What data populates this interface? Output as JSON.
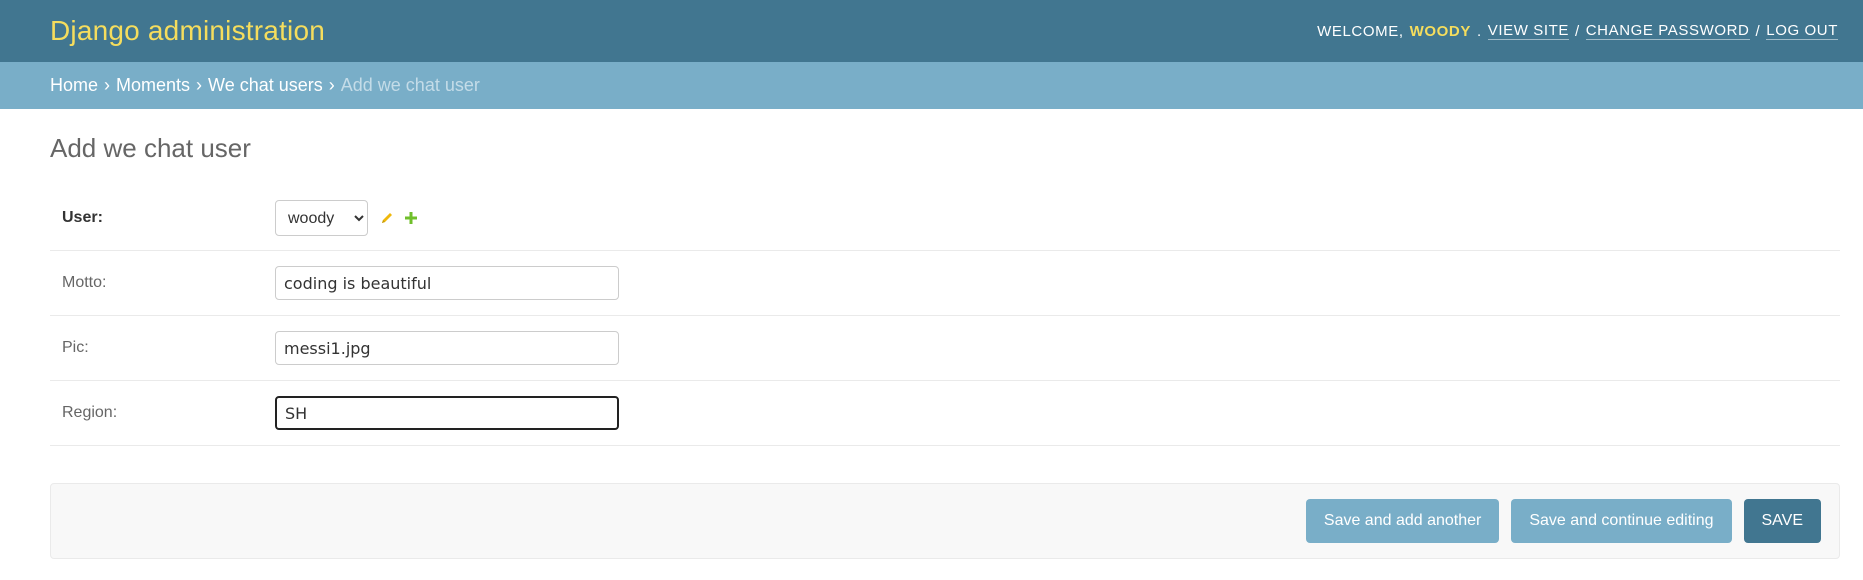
{
  "header": {
    "branding": "Django administration",
    "welcome": "Welcome,",
    "username": "woody",
    "view_site": "View site",
    "change_password": "Change password",
    "log_out": "Log out"
  },
  "breadcrumbs": {
    "home": "Home",
    "app": "Moments",
    "model": "We chat users",
    "current": "Add we chat user"
  },
  "page": {
    "title": "Add we chat user"
  },
  "form": {
    "user": {
      "label": "User:",
      "selected": "woody"
    },
    "motto": {
      "label": "Motto:",
      "value": "coding is beautiful"
    },
    "pic": {
      "label": "Pic:",
      "value": "messi1.jpg"
    },
    "region": {
      "label": "Region:",
      "value": "SH"
    }
  },
  "submit": {
    "save_add_another": "Save and add another",
    "save_continue": "Save and continue editing",
    "save": "Save"
  },
  "colors": {
    "header_bg": "#417690",
    "branding": "#f5dd5d",
    "breadcrumbs_bg": "#79aec8",
    "button": "#79aec8",
    "default_button": "#417690"
  },
  "icons": {
    "change_related": "pencil-icon",
    "add_related": "plus-icon"
  }
}
